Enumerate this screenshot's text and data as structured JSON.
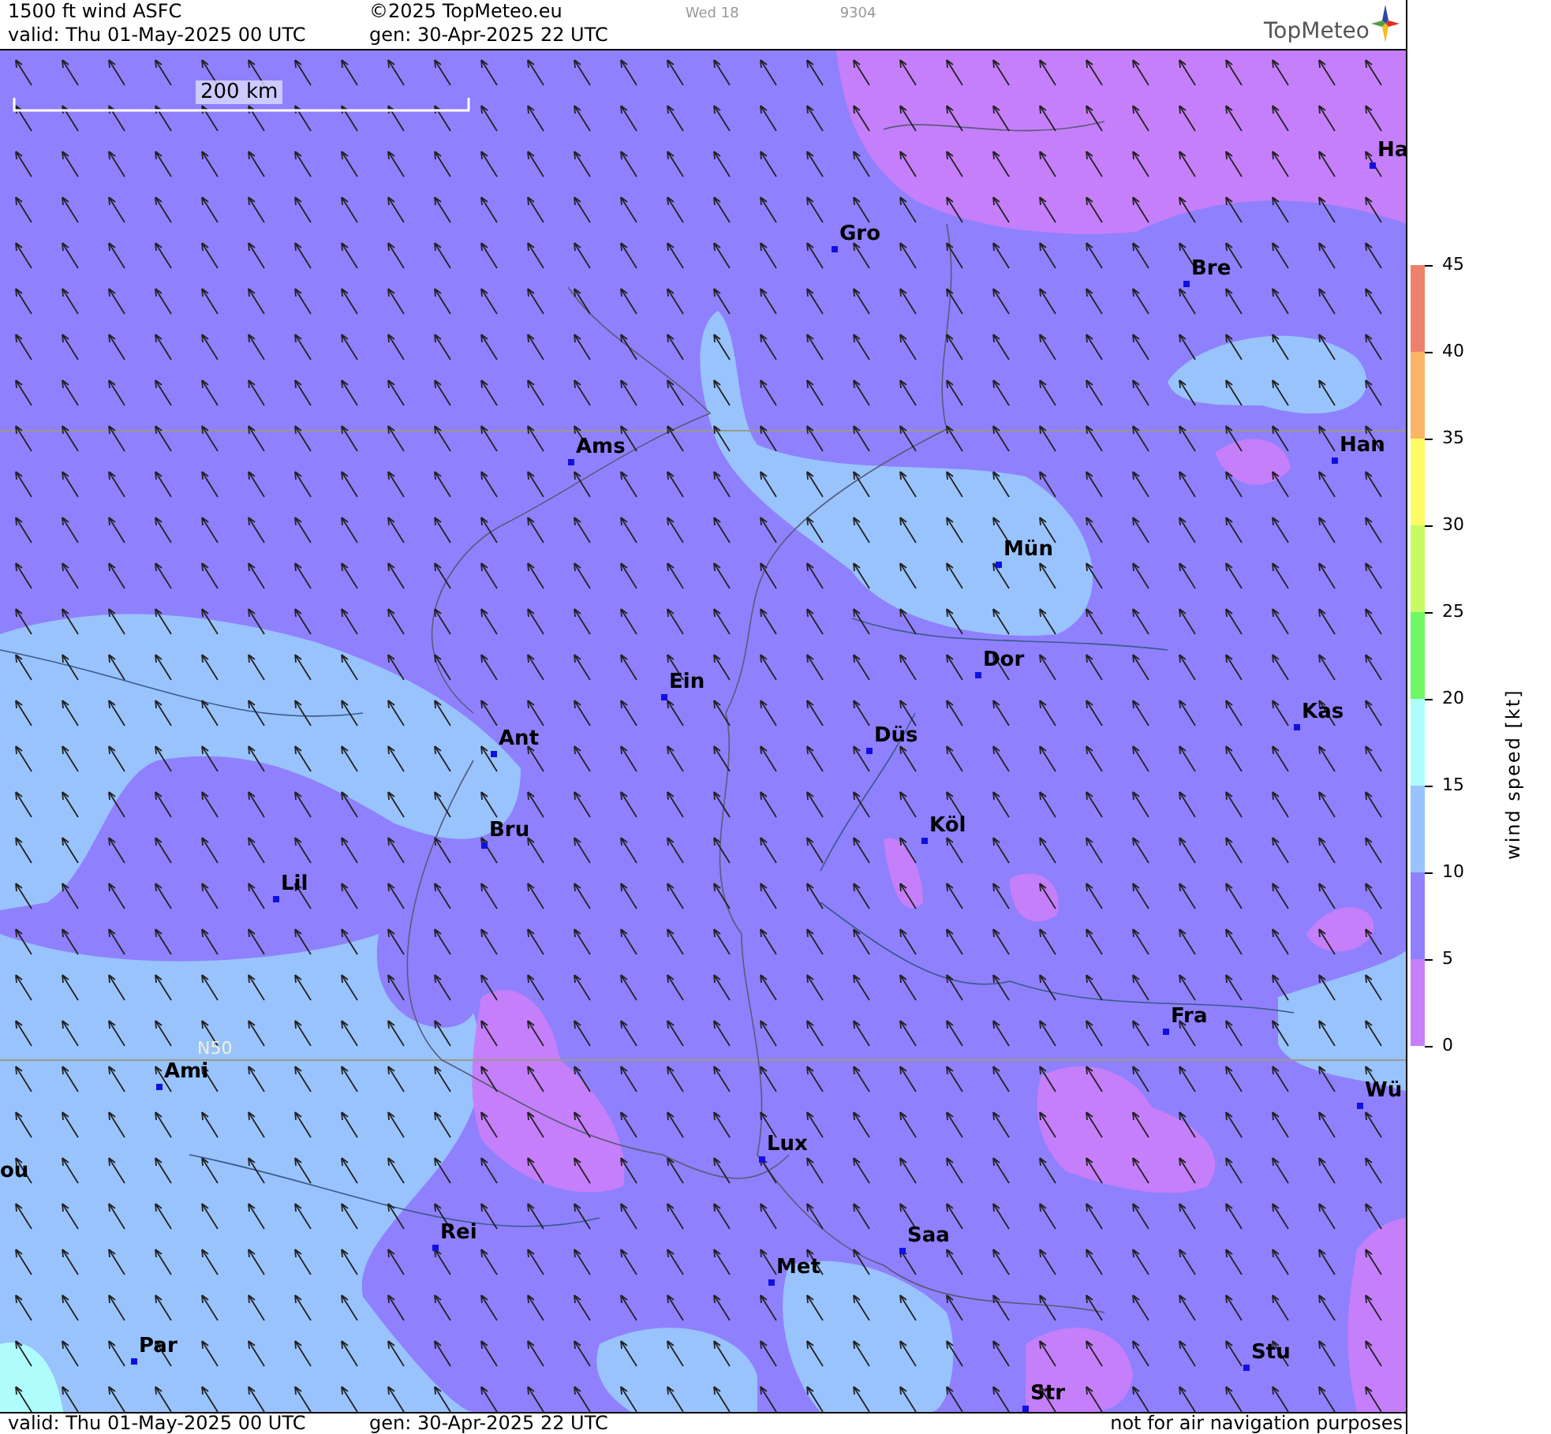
{
  "header": {
    "title": "1500 ft wind ASFC",
    "copyright": "©2025 TopMeteo.eu",
    "day": "Wed 18",
    "code": "9304",
    "valid": "valid:  Thu  01-May-2025  00 UTC",
    "generated": "gen: 30-Apr-2025 22 UTC",
    "logo": "TopMeteo"
  },
  "map": {
    "scale_bar": "200 km",
    "grid_label": "N50",
    "cities": [
      {
        "name": "Ha"
      },
      {
        "name": "Gro"
      },
      {
        "name": "Bre"
      },
      {
        "name": "Ams"
      },
      {
        "name": "Han"
      },
      {
        "name": "Mün"
      },
      {
        "name": "Dor"
      },
      {
        "name": "Ein"
      },
      {
        "name": "Kas"
      },
      {
        "name": "Düs"
      },
      {
        "name": "Ant"
      },
      {
        "name": "Köl"
      },
      {
        "name": "Bru"
      },
      {
        "name": "Lil"
      },
      {
        "name": "Fra"
      },
      {
        "name": "Ami"
      },
      {
        "name": "Wü"
      },
      {
        "name": "Lux"
      },
      {
        "name": "ou"
      },
      {
        "name": "Rei"
      },
      {
        "name": "Saa"
      },
      {
        "name": "Met"
      },
      {
        "name": "Par"
      },
      {
        "name": "Stu"
      },
      {
        "name": "Str"
      }
    ]
  },
  "legend": {
    "title": "wind speed [kt]",
    "ticks": [
      "45",
      "40",
      "35",
      "30",
      "25",
      "20",
      "15",
      "10",
      "5",
      "0"
    ],
    "bands": [
      {
        "color": "#ef806c"
      },
      {
        "color": "#fcb466"
      },
      {
        "color": "#fdfc64"
      },
      {
        "color": "#c6fb64"
      },
      {
        "color": "#6ef964"
      },
      {
        "color": "#affcfd"
      },
      {
        "color": "#99c3fd"
      },
      {
        "color": "#8f80fd"
      },
      {
        "color": "#c57ffa"
      }
    ]
  },
  "footer": {
    "valid": "valid:  Thu  01-May-2025  00 UTC",
    "generated": "gen: 30-Apr-2025 22 UTC",
    "notice": "not for air navigation purposes"
  }
}
